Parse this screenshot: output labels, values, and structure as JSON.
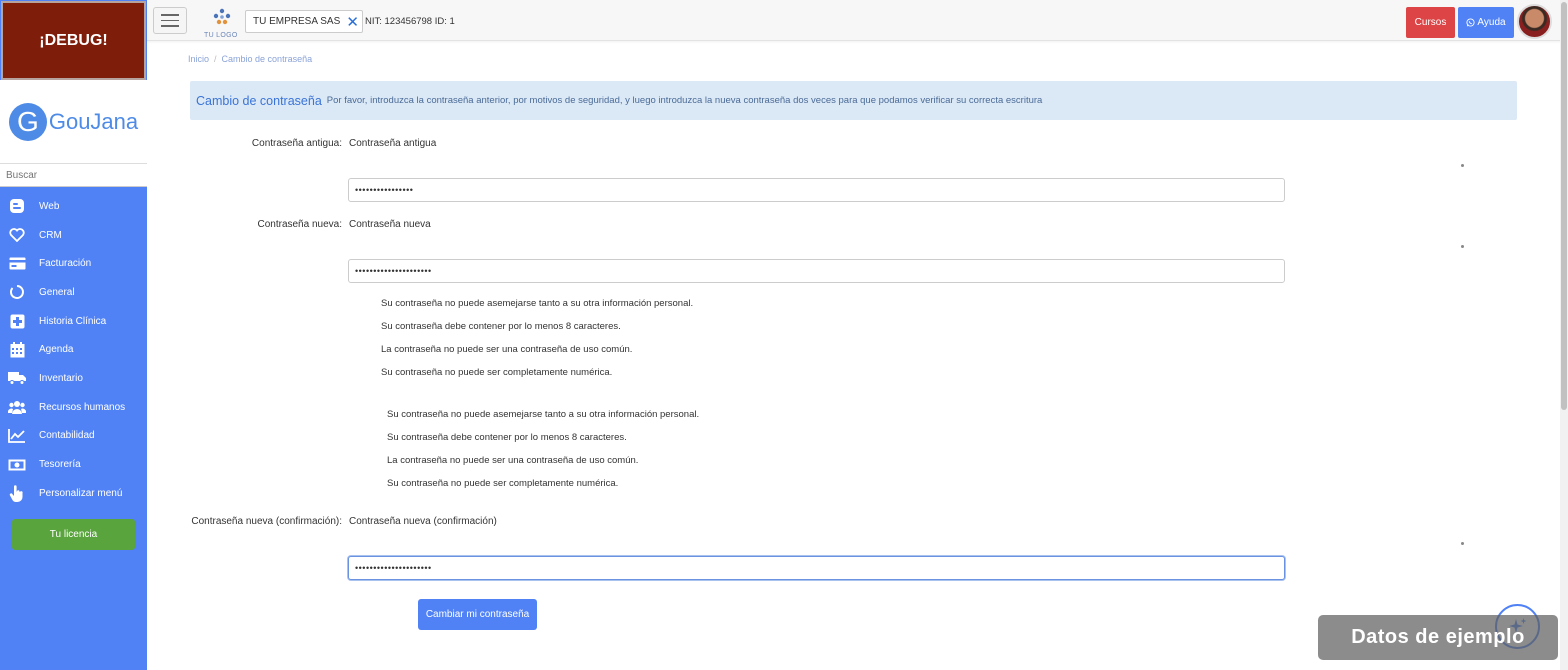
{
  "debug_label": "¡DEBUG!",
  "brand": {
    "mark": "G",
    "name": "GouJana"
  },
  "search": {
    "placeholder": "Buscar"
  },
  "sidebar": {
    "items": [
      {
        "label": "Web",
        "icon": "blog-icon"
      },
      {
        "label": "CRM",
        "icon": "heart-icon"
      },
      {
        "label": "Facturación",
        "icon": "credit-card-icon"
      },
      {
        "label": "General",
        "icon": "circle-notch-icon"
      },
      {
        "label": "Historia Clínica",
        "icon": "medical-plus-icon"
      },
      {
        "label": "Agenda",
        "icon": "calendar-icon"
      },
      {
        "label": "Inventario",
        "icon": "truck-icon"
      },
      {
        "label": "Recursos humanos",
        "icon": "users-icon"
      },
      {
        "label": "Contabilidad",
        "icon": "chart-line-icon"
      },
      {
        "label": "Tesorería",
        "icon": "money-bill-icon"
      },
      {
        "label": "Personalizar menú",
        "icon": "hand-pointer-icon"
      }
    ],
    "license_button": "Tu licencia"
  },
  "header": {
    "tu_logo": "TU LOGO",
    "company": "TU EMPRESA SAS",
    "nit": "NIT: 123456798 ID: 1",
    "cursos": "Cursos",
    "ayuda": "Ayuda"
  },
  "breadcrumb": {
    "home": "Inicio",
    "separator": "/",
    "current": "Cambio de contraseña"
  },
  "alert": {
    "title": "Cambio de contraseña",
    "description": "Por favor, introduzca la contraseña anterior, por motivos de seguridad, y luego introduzca la nueva contraseña dos veces para que podamos verificar su correcta escritura"
  },
  "form": {
    "old": {
      "label": "Contraseña antigua:",
      "title": "Contraseña antigua",
      "value": "••••••••••••••••"
    },
    "new": {
      "label": "Contraseña nueva:",
      "title": "Contraseña nueva",
      "value": "•••••••••••••••••••••"
    },
    "confirm": {
      "label": "Contraseña nueva (confirmación):",
      "title": "Contraseña nueva (confirmación)",
      "value": "•••••••••••••••••••••"
    },
    "required_mark": "*",
    "help1": [
      "Su contraseña no puede asemejarse tanto a su otra información personal.",
      "Su contraseña debe contener por lo menos 8 caracteres.",
      "La contraseña no puede ser una contraseña de uso común.",
      "Su contraseña no puede ser completamente numérica."
    ],
    "help2": [
      "Su contraseña no puede asemejarse tanto a su otra información personal.",
      "Su contraseña debe contener por lo menos 8 caracteres.",
      "La contraseña no puede ser una contraseña de uso común.",
      "Su contraseña no puede ser completamente numérica."
    ],
    "submit": "Cambiar mi contraseña"
  },
  "watermark": "Datos de ejemplo",
  "colors": {
    "sidebar": "#5082f5",
    "debug": "#7f1d0b",
    "license": "#5aa43e",
    "cursos": "#dd4446",
    "alert_bg": "#dbe9f7",
    "accent": "#3b74d6"
  }
}
